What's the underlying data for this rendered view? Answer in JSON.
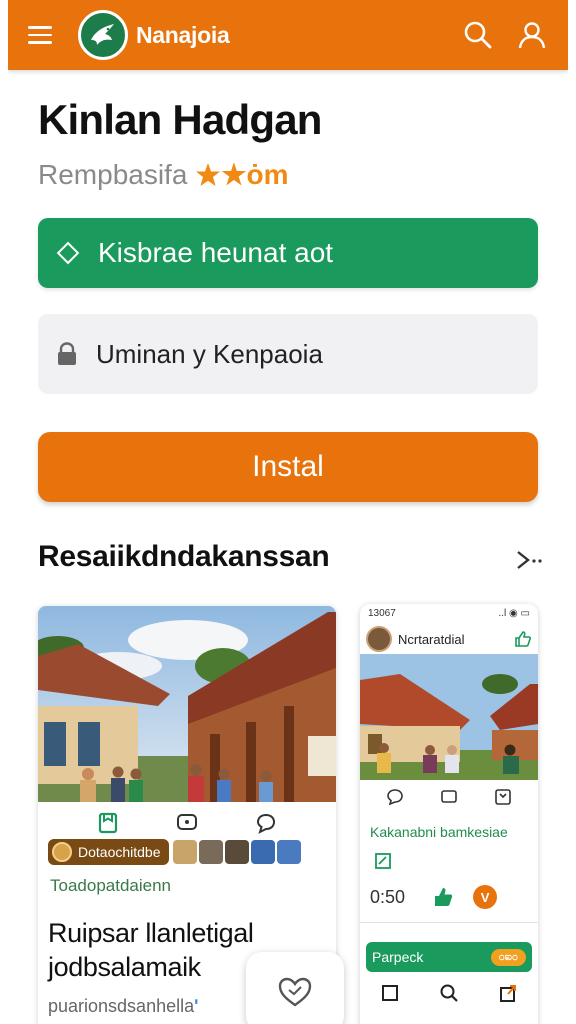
{
  "colors": {
    "primary_orange": "#e8720c",
    "primary_green": "#1a9a5c",
    "logo_green": "#1d7d4a",
    "chip_brown": "#7a4a14",
    "star_orange": "#f08a12",
    "link_green": "#1f8c4e",
    "badge_orange": "#e8720c",
    "banner_pill": "#f2a020"
  },
  "icons": {
    "menu": "menu-icon",
    "logo": "bird-logo-icon",
    "search": "search-icon",
    "profile": "user-icon",
    "stars": "star-icon",
    "diamond": "diamond-icon",
    "lock": "lock-icon",
    "more": "chevron-right-icon",
    "heart": "heart-icon"
  },
  "appbar": {
    "brand": "Nanajoia"
  },
  "header": {
    "title": "Kinlan Hadgan",
    "subtitle": "Rempbasifa",
    "subtitle_accent": "★ȯm"
  },
  "primary_action": {
    "label": "Kisbrae heunat aot"
  },
  "field": {
    "value": "Uminan y Kenpaoia"
  },
  "install": {
    "label": "Instal"
  },
  "section": {
    "title": "Resaiikdndakanssan",
    "more": ">..."
  },
  "card": {
    "chip_label": "Dotaochitdbe",
    "tag": "Toadopatdaienn",
    "title_line1": "Ruipsar llanletigal",
    "title_line2": "jodbsalamaik",
    "footer": "puarionsdsanhella",
    "footer_mark": "ʹ"
  },
  "phone_card": {
    "status_time": "13067",
    "status_icons": "..l ◉ ▭",
    "username": "Ncrtaratdial",
    "link_text": "Kakanabni bamkesiae",
    "time": "0:50",
    "badge": "V",
    "banner_label": "Parpeck",
    "banner_pill": "೦ಐ೦"
  }
}
